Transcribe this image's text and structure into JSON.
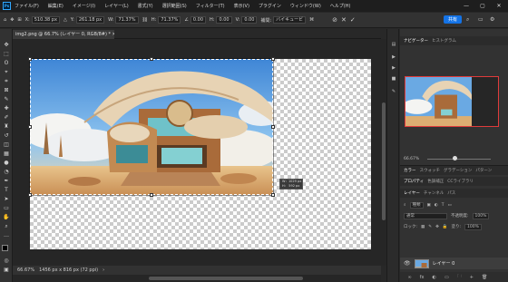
{
  "app": {
    "logo": "Ps",
    "menus": [
      "ファイル(F)",
      "編集(E)",
      "イメージ(I)",
      "レイヤー(L)",
      "書式(Y)",
      "選択範囲(S)",
      "フィルター(T)",
      "表示(V)",
      "プラグイン",
      "ウィンドウ(W)",
      "ヘルプ(H)"
    ],
    "share_label": "共有",
    "window_controls": [
      "—",
      "▢",
      "✕"
    ]
  },
  "options": {
    "x_label": "X:",
    "x_value": "510.38 px",
    "y_label": "Y:",
    "y_value": "261.18 px",
    "w_label": "W:",
    "w_value": "71.37%",
    "h_label": "H:",
    "h_value": "71.37%",
    "angle_value": "0.00",
    "hskew_label": "H:",
    "hskew_value": "0.00",
    "vskew_label": "V:",
    "vskew_value": "0.00",
    "interp_label": "補間:",
    "interp_value": "バイキュービ"
  },
  "document": {
    "tab_label": "img2.png @ 66.7% (レイヤー 0, RGB/8#) *"
  },
  "tooltip": {
    "line1": "W：1029 px",
    "line2": "H：  592 px"
  },
  "status": {
    "zoom": "66.67%",
    "doc_info": "1456 px x 816 px (72 ppi)"
  },
  "panels": {
    "top_tabs": [
      "ナビゲーター",
      "ヒストグラム"
    ],
    "nav_zoom": "66.67%",
    "color_tabs": [
      "カラー",
      "スウォッチ",
      "グラデーション",
      "パターン"
    ],
    "prop_tabs": [
      "プロパティ",
      "色調補正",
      "CCライブラリ"
    ],
    "layer_tabs": [
      "レイヤー",
      "チャンネル",
      "パス"
    ],
    "search_kind": "種類",
    "blend_mode": "通常",
    "opacity_label": "不透明度:",
    "opacity_value": "100%",
    "lock_label": "ロック:",
    "fill_label": "塗り:",
    "fill_value": "100%",
    "layer_name": "レイヤー 0",
    "bottom_icons": [
      "∞",
      "fx",
      "◐",
      "▭",
      "🗀",
      "+",
      "🗑"
    ]
  },
  "colors": {
    "accent": "#1473e6",
    "selection": "#ffffff",
    "nav_frame": "#e03b3b"
  }
}
